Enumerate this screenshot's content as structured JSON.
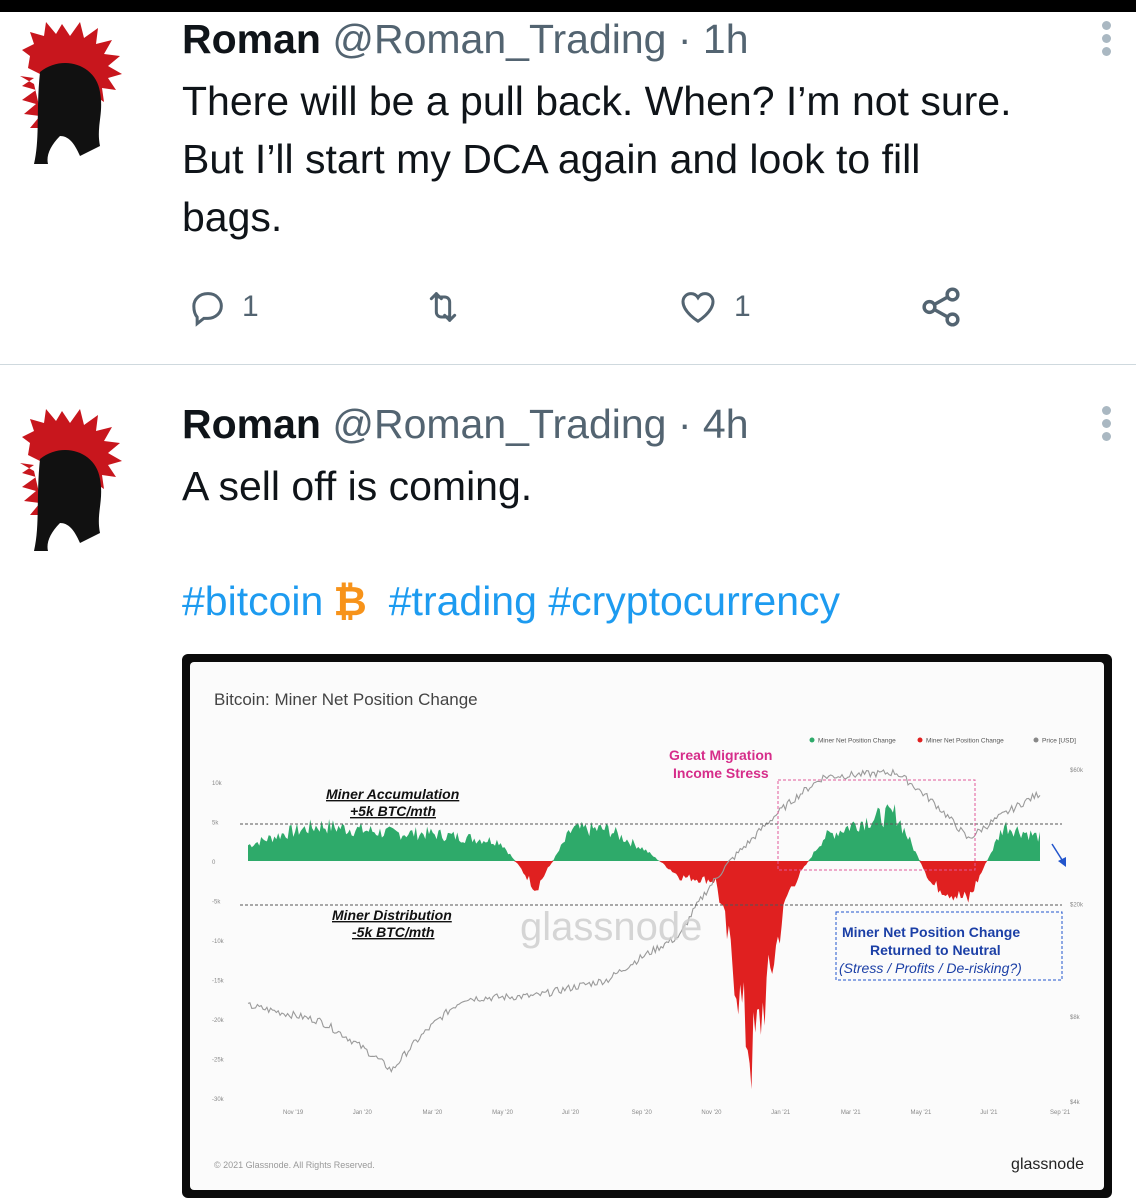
{
  "tweets": [
    {
      "name": "Roman",
      "handle": "@Roman_Trading",
      "time": "· 1h",
      "lines": [
        "There will be a pull back. When? I’m not sure.",
        "But I’ll start my DCA again and look to fill",
        "bags."
      ],
      "reply_count": "1",
      "like_count": "1"
    },
    {
      "name": "Roman",
      "handle": "@Roman_Trading",
      "time": "· 4h",
      "text": "A sell off is coming.",
      "hashtags": [
        "#bitcoin",
        "#trading",
        "#cryptocurrency"
      ],
      "bitcoin_symbol": "₿"
    }
  ],
  "colors": {
    "accent": "#1d9bf0",
    "positive": "#2eaa6a",
    "negative": "#e02020",
    "helmet": "#c8161d",
    "bitcoin": "#f7931a"
  },
  "icons": [
    "reply-icon",
    "retweet-icon",
    "like-icon",
    "share-icon",
    "more-icon"
  ],
  "chart": {
    "title": "Bitcoin: Miner Net Position Change",
    "legend": [
      "Miner Net Position Change",
      "Miner Net Position Change",
      "Price [USD]"
    ],
    "ann_acc_1": "Miner Accumulation",
    "ann_acc_2": "+5k BTC/mth",
    "ann_dist_1": "Miner Distribution",
    "ann_dist_2": "-5k BTC/mth",
    "ann_mig_1": "Great Migration",
    "ann_mig_2": "Income Stress",
    "ann_neu_1": "Miner Net Position Change",
    "ann_neu_2": "Returned to Neutral",
    "ann_neu_3": "(Stress / Profits / De-risking?)",
    "watermark": "glassnode",
    "footer_left": "© 2021 Glassnode. All Rights Reserved.",
    "footer_right": "glassnode"
  },
  "chart_data": {
    "type": "area",
    "x_ticks": [
      "Nov '19",
      "Jan '20",
      "Mar '20",
      "May '20",
      "Jul '20",
      "Sep '20",
      "Nov '20",
      "Jan '21",
      "Mar '21",
      "May '21",
      "Jul '21",
      "Sep '21"
    ],
    "y_left_ticks": [
      "10k",
      "5k",
      "0",
      "-5k",
      "-10k",
      "-15k",
      "-20k",
      "-25k",
      "-30k"
    ],
    "y_right_ticks": [
      "$60k",
      "$20k",
      "$8k",
      "$4k"
    ],
    "ylim": [
      -30000,
      10000
    ],
    "price_scale": "log",
    "series": [
      {
        "name": "Miner Net Position Change",
        "x": [
          "Nov '19",
          "Dec '19",
          "Jan '20",
          "Feb '20",
          "Mar '20",
          "Apr '20",
          "May '20",
          "Jun '20",
          "Jul '20",
          "Aug '20",
          "Sep '20",
          "Oct '20",
          "Nov '20",
          "Dec '20",
          "Jan '21",
          "Feb '21",
          "Mar '21",
          "Apr '21",
          "May '21",
          "Jun '21",
          "Jul '21",
          "Aug '21",
          "Sep '21"
        ],
        "values": [
          2000,
          3500,
          4500,
          4000,
          3500,
          3500,
          3000,
          2500,
          -3500,
          4000,
          4000,
          1500,
          -2000,
          -2500,
          -25000,
          -4000,
          3000,
          5000,
          6000,
          -3000,
          -5000,
          4500,
          3000
        ]
      },
      {
        "name": "Price [USD]",
        "x": [
          "Nov '19",
          "Jan '20",
          "Mar '20",
          "May '20",
          "Jul '20",
          "Sep '20",
          "Nov '20",
          "Jan '21",
          "Mar '21",
          "May '21",
          "Jul '21",
          "Sep '21"
        ],
        "values": [
          8500,
          7500,
          5000,
          9000,
          9200,
          10500,
          15000,
          33000,
          55000,
          57000,
          33000,
          48000
        ]
      }
    ]
  }
}
